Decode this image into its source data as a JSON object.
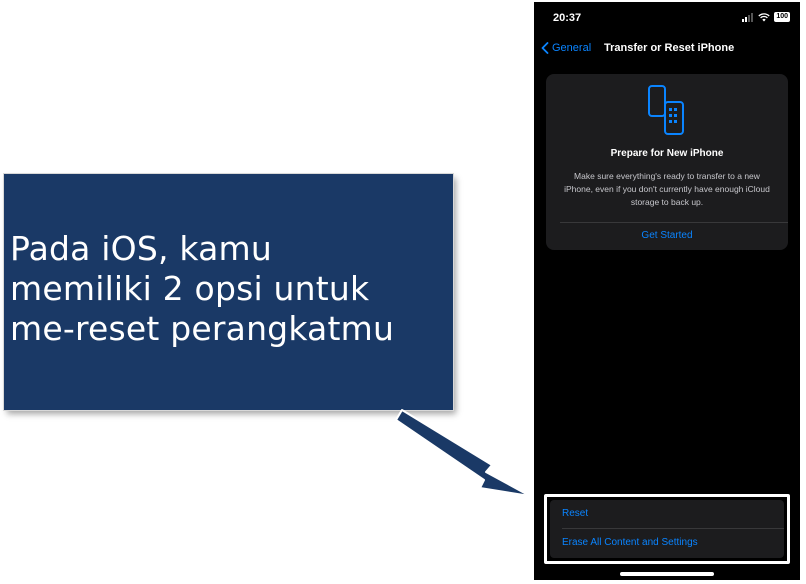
{
  "callout": {
    "text": " Pada iOS, kamu\nmemiliki 2 opsi untuk\nme-reset perangkatmu",
    "bg_color": "#1a3966"
  },
  "status_bar": {
    "time": "20:37",
    "battery": "100",
    "icons": [
      "signal-icon",
      "wifi-icon",
      "battery-icon"
    ]
  },
  "nav": {
    "back_label": "General",
    "title": "Transfer or Reset iPhone"
  },
  "prepare_card": {
    "icon": "phones-transfer-icon",
    "title": "Prepare for New iPhone",
    "description": "Make sure everything's ready to transfer to a new iPhone, even if you don't currently have enough iCloud storage to back up.",
    "action_label": "Get Started"
  },
  "reset_options": {
    "items": [
      {
        "label": "Reset"
      },
      {
        "label": "Erase All Content and Settings"
      }
    ]
  },
  "colors": {
    "accent": "#0a84ff",
    "background": "#000000",
    "card": "#1c1c1e"
  }
}
